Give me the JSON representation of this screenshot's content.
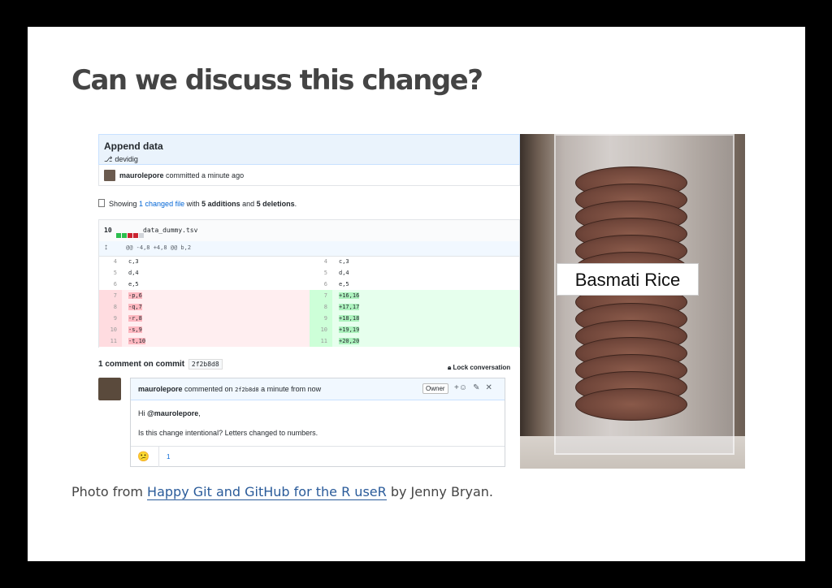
{
  "slide": {
    "title": "Can we discuss this change?",
    "caption": {
      "prefix": "Photo from ",
      "link_text": "Happy Git and GitHub for the R useR",
      "suffix": " by Jenny Bryan."
    }
  },
  "github": {
    "commit_title": "Append data",
    "branch": "devidig",
    "committer": "maurolepore",
    "committed_text": "committed a minute ago",
    "showing_prefix": "Showing ",
    "changed_files": "1 changed file",
    "showing_mid": " with ",
    "additions": "5 additions",
    "showing_and": " and ",
    "deletions": "5 deletions",
    "showing_end": ".",
    "file": {
      "change_count": "10",
      "diffstat_colors": [
        "#2cbe4e",
        "#2cbe4e",
        "#cb2431",
        "#cb2431",
        "#d1d5da"
      ],
      "name": "data_dummy.tsv",
      "hunk_header": "@@ -4,8 +4,8 @@ b,2"
    },
    "diff_context": [
      {
        "ln": "4",
        "code": "c,3"
      },
      {
        "ln": "5",
        "code": "d,4"
      },
      {
        "ln": "6",
        "code": "e,5"
      }
    ],
    "diff_changes": [
      {
        "ln": "7",
        "del": "-p,6",
        "add": "+16,16"
      },
      {
        "ln": "8",
        "del": "-q,7",
        "add": "+17,17"
      },
      {
        "ln": "9",
        "del": "-r,8",
        "add": "+18,18"
      },
      {
        "ln": "10",
        "del": "-s,9",
        "add": "+19,19"
      },
      {
        "ln": "11",
        "del": "-t,10",
        "add": "+20,20"
      }
    ],
    "comment_count_text": "1 comment on commit",
    "commit_sha": "2f2b8d8",
    "lock_text": "Lock conversation",
    "comment": {
      "author": "maurolepore",
      "commented_on": "commented on",
      "sha": "2f2b8d8",
      "when": "a minute from now",
      "owner_badge": "Owner",
      "line1_prefix": "Hi ",
      "mention": "@maurolepore",
      "line1_suffix": ",",
      "line2": "Is this change intentional? Letters changed to numbers.",
      "reaction_count": "1"
    }
  },
  "photo": {
    "label": "Basmati  Rice"
  }
}
